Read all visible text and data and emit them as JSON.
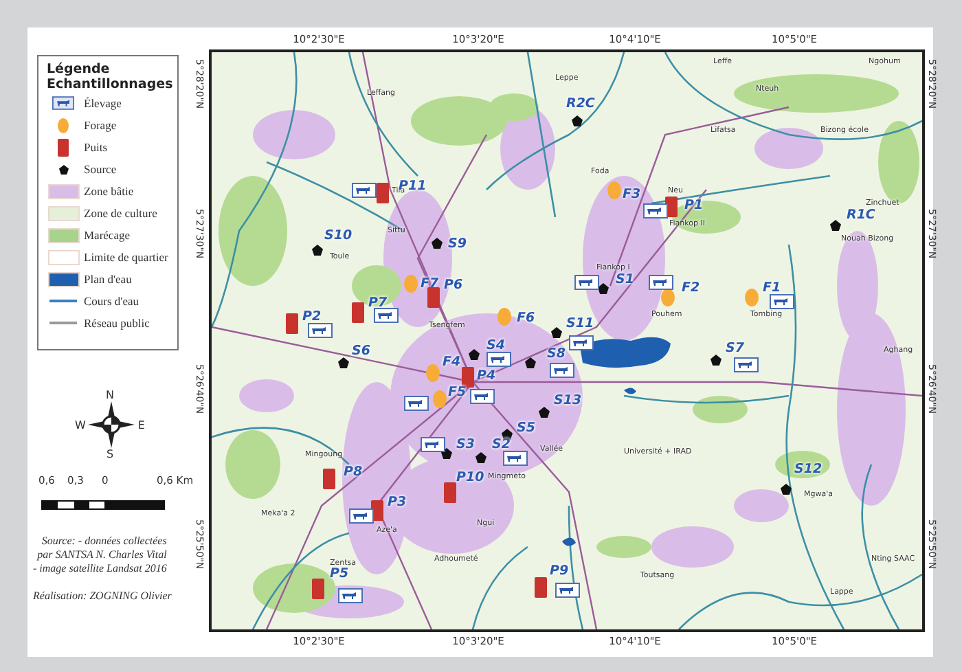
{
  "legend": {
    "title": "Légende",
    "subtitle": "Echantillonnages",
    "items": [
      {
        "kind": "elevage",
        "label": "Élevage"
      },
      {
        "kind": "forage",
        "label": "Forage"
      },
      {
        "kind": "puits",
        "label": "Puits"
      },
      {
        "kind": "source",
        "label": "Source"
      },
      {
        "kind": "area",
        "label": "Zone bâtie",
        "color": "#d9bde8"
      },
      {
        "kind": "area",
        "label": "Zone de culture",
        "color": "#e6f0d8"
      },
      {
        "kind": "area",
        "label": "Marécage",
        "color": "#a8d38a"
      },
      {
        "kind": "area",
        "label": "Limite de quartier",
        "color": "#ffffff"
      },
      {
        "kind": "area",
        "label": "Plan d'eau",
        "color": "#1f5fb0"
      },
      {
        "kind": "line",
        "label": "Cours d'eau",
        "color": "#3b7fc0"
      },
      {
        "kind": "line",
        "label": "Réseau public",
        "color": "#9a9a9a"
      }
    ]
  },
  "compass": {
    "north": "N",
    "west": "W",
    "east": "E",
    "south": "S"
  },
  "scale_bar": [
    "0,6",
    "0,3",
    "0",
    "0,6 Km"
  ],
  "source_note": [
    "Source: - données collectées",
    "par SANTSA N. Charles Vital",
    "- image satellite Landsat 2016"
  ],
  "credit": "Réalisation: ZOGNING Olivier",
  "map": {
    "top_ticks": [
      "10°2'30\"E",
      "10°3'20\"E",
      "10°4'10\"E",
      "10°5'0\"E"
    ],
    "bottom_ticks": [
      "10°2'30\"E",
      "10°3'20\"E",
      "10°4'10\"E",
      "10°5'0\"E"
    ],
    "left_ticks": [
      "5°28'20\"N",
      "5°27'30\"N",
      "5°26'40\"N",
      "5°25'50\"N"
    ],
    "right_ticks": [
      "5°28'20\"N",
      "5°27'30\"N",
      "5°26'40\"N",
      "5°25'50\"N"
    ],
    "sites": [
      {
        "code": "R2C",
        "kind": "source",
        "livestock": false
      },
      {
        "code": "P11",
        "kind": "puits",
        "livestock": true
      },
      {
        "code": "S10",
        "kind": "source",
        "livestock": false
      },
      {
        "code": "S9",
        "kind": "source",
        "livestock": false
      },
      {
        "code": "F7",
        "kind": "forage",
        "livestock": false
      },
      {
        "code": "P6",
        "kind": "puits",
        "livestock": false
      },
      {
        "code": "P7",
        "kind": "puits",
        "livestock": true
      },
      {
        "code": "P2",
        "kind": "puits",
        "livestock": true
      },
      {
        "code": "F6",
        "kind": "forage",
        "livestock": false
      },
      {
        "code": "S11",
        "kind": "source",
        "livestock": true
      },
      {
        "code": "S6",
        "kind": "source",
        "livestock": false
      },
      {
        "code": "S4",
        "kind": "source",
        "livestock": true
      },
      {
        "code": "S8",
        "kind": "source",
        "livestock": true
      },
      {
        "code": "F4",
        "kind": "forage",
        "livestock": false
      },
      {
        "code": "P4",
        "kind": "puits",
        "livestock": true
      },
      {
        "code": "F5",
        "kind": "forage",
        "livestock": true
      },
      {
        "code": "S13",
        "kind": "source",
        "livestock": false
      },
      {
        "code": "S5",
        "kind": "source",
        "livestock": false
      },
      {
        "code": "S3",
        "kind": "source",
        "livestock": true
      },
      {
        "code": "S2",
        "kind": "source",
        "livestock": true
      },
      {
        "code": "P8",
        "kind": "puits",
        "livestock": false
      },
      {
        "code": "P10",
        "kind": "puits",
        "livestock": false
      },
      {
        "code": "P3",
        "kind": "puits",
        "livestock": true
      },
      {
        "code": "P5",
        "kind": "puits",
        "livestock": true
      },
      {
        "code": "P9",
        "kind": "puits",
        "livestock": true
      },
      {
        "code": "S12",
        "kind": "source",
        "livestock": false
      },
      {
        "code": "S7",
        "kind": "source",
        "livestock": true
      },
      {
        "code": "F2",
        "kind": "forage",
        "livestock": true
      },
      {
        "code": "F1",
        "kind": "forage",
        "livestock": true
      },
      {
        "code": "S1",
        "kind": "source",
        "livestock": true
      },
      {
        "code": "F3",
        "kind": "forage",
        "livestock": false
      },
      {
        "code": "P1",
        "kind": "puits",
        "livestock": true
      },
      {
        "code": "R1C",
        "kind": "source",
        "livestock": false
      }
    ],
    "places": [
      "Leffang",
      "Tila",
      "Sittu",
      "Toule",
      "Leffe",
      "Nteuh",
      "Ngohum",
      "Leppe",
      "Lifatsa",
      "Bizong école",
      "Foda",
      "Neu",
      "Fiankop II",
      "Zinchuet",
      "Nouah Bizong",
      "Fiankop I",
      "Pouhem",
      "Tombing",
      "Tsengfem",
      "Aghang",
      "Mingoung",
      "Meka'a 2",
      "Aze'a",
      "Ngui",
      "Adhoumeté",
      "Zentsa",
      "Toutsang",
      "Lappe",
      "Nting SAAC",
      "Mgwa'a",
      "Mingmeto",
      "Vallée",
      "Université + IRAD"
    ]
  }
}
